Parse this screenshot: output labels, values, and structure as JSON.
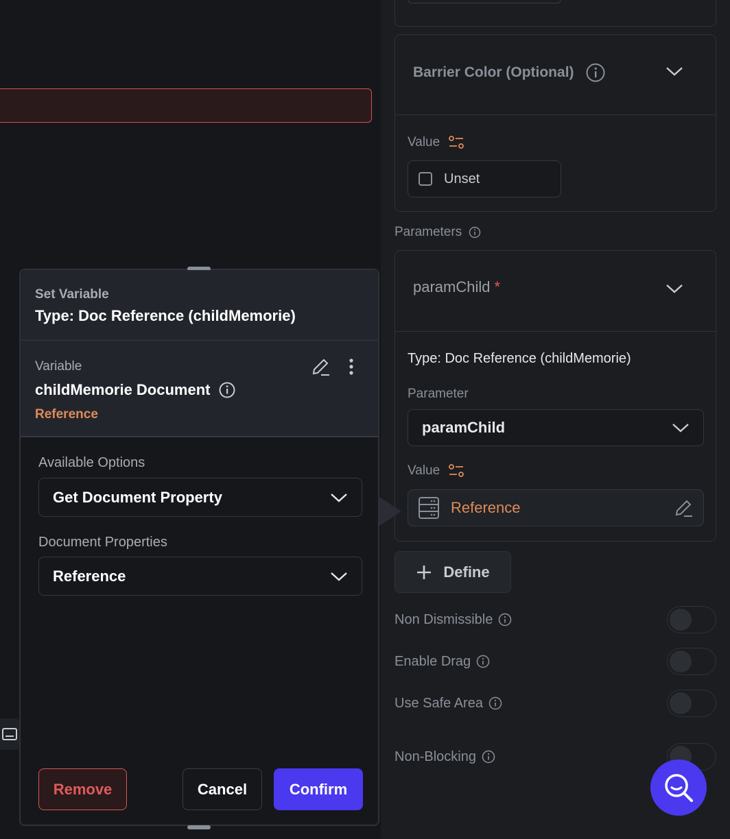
{
  "panel": {
    "barrier": {
      "title": "Barrier Color (Optional)",
      "value_label": "Value",
      "unset_label": "Unset"
    },
    "parameters_label": "Parameters",
    "param": {
      "name": "paramChild",
      "required_mark": "*",
      "type_text": "Type: Doc Reference (childMemorie)",
      "parameter_label": "Parameter",
      "parameter_value": "paramChild",
      "value_label": "Value",
      "value_text": "Reference"
    },
    "define_label": "Define",
    "toggles": [
      {
        "label": "Non Dismissible",
        "on": false
      },
      {
        "label": "Enable Drag",
        "on": false
      },
      {
        "label": "Use Safe Area",
        "on": false
      },
      {
        "label": "Non-Blocking",
        "on": false
      }
    ]
  },
  "modal": {
    "kicker": "Set Variable",
    "type_title": "Type: Doc Reference (childMemorie)",
    "variable_label": "Variable",
    "variable_name": "childMemorie Document",
    "variable_sub": "Reference",
    "available_options_label": "Available Options",
    "available_option_value": "Get Document Property",
    "document_properties_label": "Document Properties",
    "document_property_value": "Reference",
    "remove_label": "Remove",
    "cancel_label": "Cancel",
    "confirm_label": "Confirm"
  },
  "colors": {
    "accent": "#4b39ef",
    "reference_orange": "#e08a5a",
    "danger": "#d9534f",
    "required": "#e05a5a"
  }
}
